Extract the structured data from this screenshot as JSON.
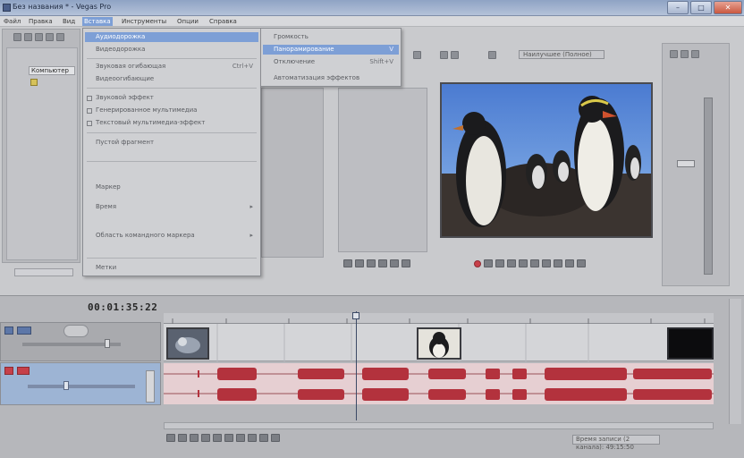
{
  "window": {
    "title": "Без названия * - Vegas Pro"
  },
  "menubar": {
    "items": [
      {
        "label": "Файл",
        "active": false
      },
      {
        "label": "Правка",
        "active": false
      },
      {
        "label": "Вид",
        "active": false
      },
      {
        "label": "Вставка",
        "active": true
      },
      {
        "label": "Инструменты",
        "active": false
      },
      {
        "label": "Опции",
        "active": false
      },
      {
        "label": "Справка",
        "active": false
      }
    ]
  },
  "explorer": {
    "items": [
      "Компьютер"
    ]
  },
  "insert_menu": {
    "items": [
      {
        "label": "Аудиодорожка",
        "shortcut": "",
        "highlighted": true
      },
      {
        "label": "Видеодорожка",
        "shortcut": "",
        "highlighted": false
      },
      {
        "label": "Звуковая огибающая",
        "shortcut": "Ctrl+V",
        "highlighted": false
      },
      {
        "label": "Видеоогибающие",
        "shortcut": "",
        "highlighted": false
      },
      {
        "label": "Звуковой эффект",
        "shortcut": "",
        "highlighted": false
      },
      {
        "label": "Генерированное мультимедиа",
        "shortcut": "",
        "highlighted": false
      },
      {
        "label": "Текстовый мультимедиа-эффект",
        "shortcut": "",
        "highlighted": false
      },
      {
        "label": "Пустой фрагмент",
        "shortcut": "",
        "highlighted": false
      },
      {
        "label": "Маркер",
        "shortcut": "",
        "highlighted": false
      },
      {
        "label": "Время",
        "shortcut": "",
        "highlighted": false
      },
      {
        "label": "Область командного маркера",
        "shortcut": "",
        "highlighted": false
      },
      {
        "label": "Метки",
        "shortcut": "",
        "highlighted": false
      }
    ]
  },
  "submenu": {
    "items": [
      {
        "label": "Громкость",
        "shortcut": "",
        "highlighted": false
      },
      {
        "label": "Панорамирование",
        "shortcut": "V",
        "highlighted": true
      },
      {
        "label": "Отключение",
        "shortcut": "Shift+V",
        "highlighted": false
      },
      {
        "label": "Автоматизация эффектов",
        "shortcut": "",
        "highlighted": false
      }
    ]
  },
  "preview": {
    "quality": "Наилучшее (Полное)"
  },
  "timeline": {
    "timecode": "00:01:35:22"
  },
  "status": {
    "record_time": "Время записи (2 канала): 49:15:50"
  },
  "colors": {
    "accent": "#7d9fd6",
    "audio_wave": "#b3323d",
    "audio_bg": "#e6cfd2"
  }
}
